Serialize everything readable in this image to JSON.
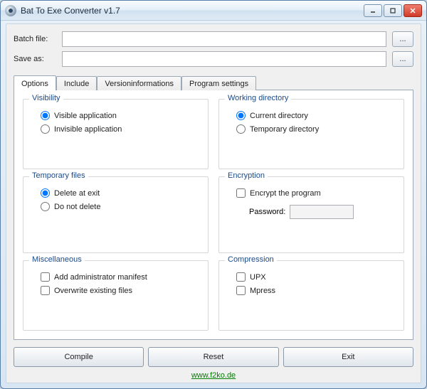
{
  "title": "Bat To Exe Converter v1.7",
  "files": {
    "batch_label": "Batch file:",
    "batch_value": "",
    "saveas_label": "Save as:",
    "saveas_value": "",
    "browse": "..."
  },
  "tabs": {
    "options": "Options",
    "include": "Include",
    "version": "Versioninformations",
    "program": "Program settings"
  },
  "groups": {
    "visibility": {
      "title": "Visibility",
      "visible": "Visible application",
      "invisible": "Invisible application"
    },
    "working_dir": {
      "title": "Working directory",
      "current": "Current directory",
      "temp": "Temporary directory"
    },
    "temp_files": {
      "title": "Temporary files",
      "delete": "Delete at exit",
      "keep": "Do not delete"
    },
    "encryption": {
      "title": "Encryption",
      "encrypt": "Encrypt the program",
      "password_label": "Password:"
    },
    "misc": {
      "title": "Miscellaneous",
      "admin": "Add administrator manifest",
      "overwrite": "Overwrite existing files"
    },
    "compression": {
      "title": "Compression",
      "upx": "UPX",
      "mpress": "Mpress"
    }
  },
  "buttons": {
    "compile": "Compile",
    "reset": "Reset",
    "exit": "Exit"
  },
  "footer": {
    "link": "www.f2ko.de"
  }
}
